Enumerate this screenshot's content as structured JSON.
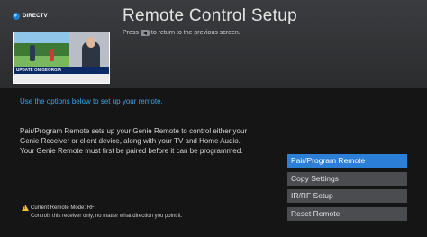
{
  "header": {
    "logo_text": "DIRECTV",
    "title": "Remote Control Setup",
    "hint_before": "Press",
    "hint_after": "to return to the previous screen."
  },
  "preview": {
    "ticker_text": "UPDATE ON GEORGIA"
  },
  "instructions": "Use the options below to set up your remote.",
  "description": {
    "line1": "Pair/Program Remote sets up your Genie Remote to control either your",
    "line2": "Genie Receiver or client device, along with your TV and Home Audio.",
    "line3": "Your Genie Remote must first be paired before it can be programmed."
  },
  "menu": {
    "selected_index": 0,
    "items": [
      {
        "label": "Pair/Program Remote"
      },
      {
        "label": "Copy Settings"
      },
      {
        "label": "IR/RF Setup"
      },
      {
        "label": "Reset Remote"
      }
    ]
  },
  "status": {
    "mode_label": "Current Remote Mode: RF",
    "mode_detail": "Controls this receiver only, no matter what direction you point it."
  },
  "colors": {
    "accent": "#2c7fd6",
    "instruction_text": "#3fa5e6",
    "warning": "#f3c12b"
  },
  "icons": {
    "back": "back-arrow-icon",
    "warning": "warning-triangle-icon",
    "logo": "directv-logo-icon"
  }
}
